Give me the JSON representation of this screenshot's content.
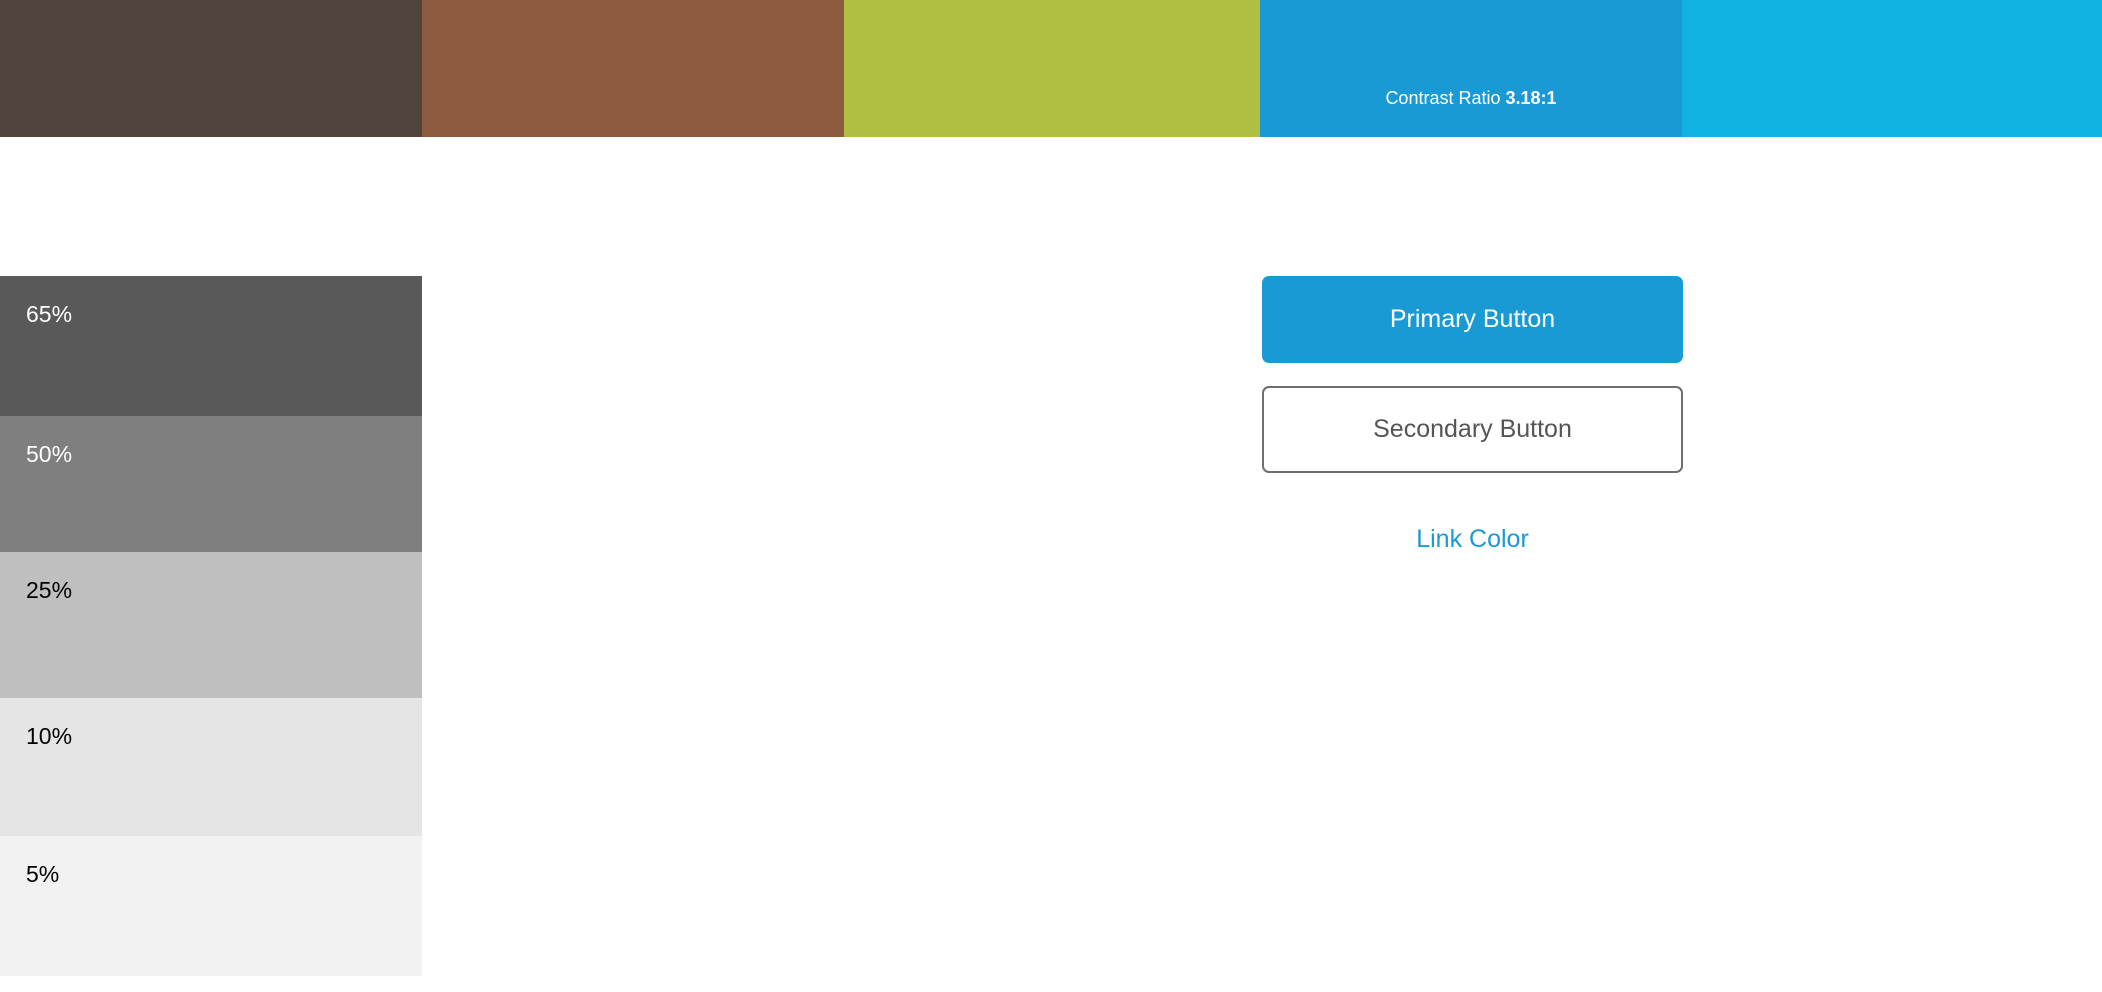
{
  "palette": {
    "swatches": [
      {
        "color": "#50433b"
      },
      {
        "color": "#8c5b40"
      },
      {
        "color": "#b0bf42"
      },
      {
        "color": "#1a9ad4",
        "label_prefix": "Contrast Ratio ",
        "label_value": "3.18:1"
      },
      {
        "color": "#10b2e2"
      }
    ]
  },
  "shades": [
    {
      "label": "65%",
      "color": "#595959",
      "text_color": "#ffffff"
    },
    {
      "label": "50%",
      "color": "#7f7f7f",
      "text_color": "#ffffff"
    },
    {
      "label": "25%",
      "color": "#bfbfbf",
      "text_color": "#000000"
    },
    {
      "label": "10%",
      "color": "#e5e5e5",
      "text_color": "#000000"
    },
    {
      "label": "5%",
      "color": "#f2f2f2",
      "text_color": "#000000"
    }
  ],
  "buttons": {
    "primary_label": "Primary Button",
    "primary_color": "#1a9ad4",
    "secondary_label": "Secondary Button",
    "secondary_border_color": "#6e6e6e"
  },
  "link": {
    "label": "Link Color",
    "color": "#1a9ad4"
  }
}
